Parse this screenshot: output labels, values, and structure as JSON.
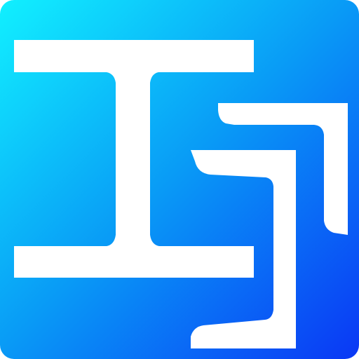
{
  "icon": {
    "name": "steel-profile-app-icon",
    "background": {
      "gradient_start": "#11f0ff",
      "gradient_mid": "#099cf6",
      "gradient_end": "#0a37f5"
    },
    "glyph_color": "#ffffff",
    "shapes": [
      "i-beam-icon",
      "channel-profile-icon",
      "angle-profile-icon"
    ]
  }
}
